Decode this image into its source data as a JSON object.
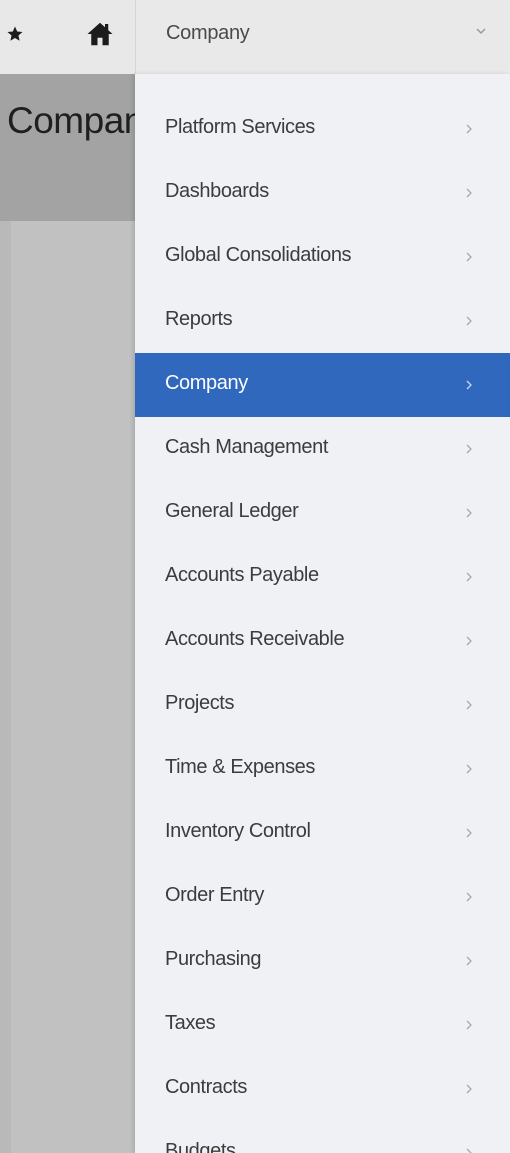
{
  "header": {
    "module_select": "Company"
  },
  "page": {
    "title": "Company"
  },
  "menu": {
    "items": [
      {
        "label": "Platform Services"
      },
      {
        "label": "Dashboards"
      },
      {
        "label": "Global Consolidations"
      },
      {
        "label": "Reports"
      },
      {
        "label": "Company",
        "active": true
      },
      {
        "label": "Cash Management"
      },
      {
        "label": "General Ledger"
      },
      {
        "label": "Accounts Payable"
      },
      {
        "label": "Accounts Receivable"
      },
      {
        "label": "Projects"
      },
      {
        "label": "Time & Expenses"
      },
      {
        "label": "Inventory Control"
      },
      {
        "label": "Order Entry"
      },
      {
        "label": "Purchasing"
      },
      {
        "label": "Taxes"
      },
      {
        "label": "Contracts"
      },
      {
        "label": "Budgets"
      }
    ]
  },
  "colors": {
    "accent": "#2f68bd",
    "menu_background": "#eff1f4",
    "top_bar": "#e8e8e8"
  },
  "icons": {
    "favorites": "star-icon",
    "home": "home-icon",
    "select": "chevron-down-icon",
    "submenu": "chevron-right-icon"
  }
}
